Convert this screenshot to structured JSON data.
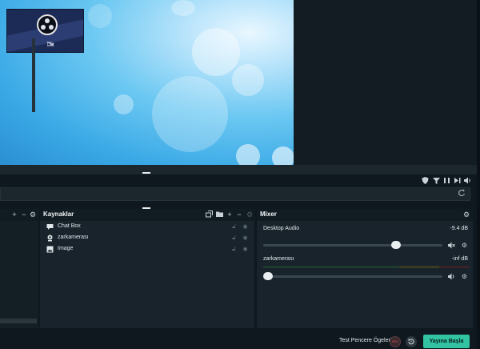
{
  "colors": {
    "background": "#0f181f",
    "panel": "#18232b",
    "accent": "#31c3a2",
    "record": "#e04a5a"
  },
  "preview": {
    "webcam_icon": "camera-off-icon",
    "logo_icon": "obs-logo-icon"
  },
  "toolbar": {
    "icons": [
      "shield-icon",
      "filter-icon",
      "pause-icon",
      "skip-icon",
      "volume-icon"
    ],
    "refresh_icon": "refresh-icon"
  },
  "scenes": {
    "icons": [
      "add-icon",
      "remove-icon",
      "gear-icon"
    ]
  },
  "sources": {
    "title": "Kaynaklar",
    "items": [
      {
        "name": "Chat Box",
        "icon": "chat-icon"
      },
      {
        "name": "zarkamerası",
        "icon": "webcam-icon"
      },
      {
        "name": "Image",
        "icon": "image-icon"
      }
    ]
  },
  "mixer": {
    "title": "Mixer",
    "channels": [
      {
        "name": "Desktop Audio",
        "db": "-9.4 dB",
        "volume_fraction": 0.74
      },
      {
        "name": "zarkamerası",
        "db": "-inf dB",
        "volume_fraction": 0.0
      }
    ]
  },
  "footer": {
    "test_label": "Test Pencere Ögeleri",
    "rec_label": "REC",
    "golive_label": "Yayına Başla"
  }
}
